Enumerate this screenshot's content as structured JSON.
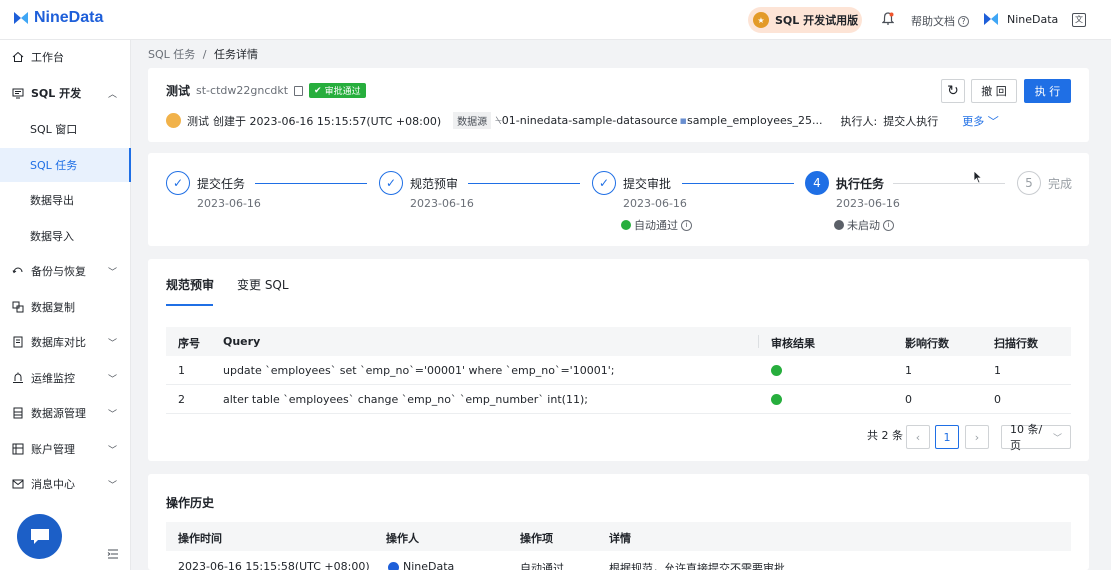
{
  "app": {
    "logo_text": "NineData",
    "trial_label": "SQL 开发试用版",
    "help_label": "帮助文档",
    "user_name": "NineData",
    "brand_color": "#1f6fe5"
  },
  "sidebar": {
    "items": [
      {
        "label": "工作台",
        "icon": "home-icon"
      },
      {
        "label": "SQL 开发",
        "icon": "sql-dev-icon"
      },
      {
        "label": "SQL 窗口"
      },
      {
        "label": "SQL 任务"
      },
      {
        "label": "数据导出"
      },
      {
        "label": "数据导入"
      },
      {
        "label": "备份与恢复",
        "icon": "backup-icon"
      },
      {
        "label": "数据复制",
        "icon": "replicate-icon"
      },
      {
        "label": "数据库对比",
        "icon": "compare-icon"
      },
      {
        "label": "运维监控",
        "icon": "monitor-icon"
      },
      {
        "label": "数据源管理",
        "icon": "datasource-icon"
      },
      {
        "label": "账户管理",
        "icon": "account-icon"
      },
      {
        "label": "消息中心",
        "icon": "message-icon"
      }
    ],
    "active": "SQL 任务"
  },
  "breadcrumb": {
    "parent": "SQL 任务",
    "separator": "/",
    "current": "任务详情"
  },
  "task": {
    "name": "测试",
    "id": "st-ctdw22gncdkt",
    "status": "审批通过",
    "creator": "测试",
    "created_text": "创建于 2023-06-16 15:15:57(UTC +08:00)",
    "datasource_label": "数据源",
    "datasource": "01-ninedata-sample-datasource",
    "database": "sample_employees_25...",
    "executor_label": "执行人:",
    "executor": "提交人执行",
    "more_label": "更多"
  },
  "buttons": {
    "refresh": "↻",
    "revoke": "撤 回",
    "execute": "执 行"
  },
  "steps": [
    {
      "title": "提交任务",
      "date": "2023-06-16",
      "state": "done",
      "note": ""
    },
    {
      "title": "规范预审",
      "date": "2023-06-16",
      "state": "done",
      "note": ""
    },
    {
      "title": "提交审批",
      "date": "2023-06-16",
      "state": "done",
      "note": "自动通过"
    },
    {
      "title": "执行任务",
      "date": "2023-06-16",
      "state": "active",
      "num": "4",
      "note": "未启动"
    },
    {
      "title": "完成",
      "date": "",
      "state": "todo",
      "num": "5",
      "note": ""
    }
  ],
  "tabs": {
    "review": "规范预审",
    "sql": "变更 SQL"
  },
  "review_table": {
    "headers": [
      "序号",
      "Query",
      "审核结果",
      "影响行数",
      "扫描行数"
    ],
    "rows": [
      {
        "no": "1",
        "query": "update `employees` set `emp_no`='00001' where `emp_no`='10001';",
        "result": "pass",
        "affected": "1",
        "scanned": "1"
      },
      {
        "no": "2",
        "query": "alter table `employees` change `emp_no` `emp_number` int(11);",
        "result": "pass",
        "affected": "0",
        "scanned": "0"
      }
    ],
    "total_text": "共 2 条",
    "page": "1",
    "page_size": "10 条/页"
  },
  "history": {
    "title": "操作历史",
    "headers": [
      "操作时间",
      "操作人",
      "操作项",
      "详情"
    ],
    "rows": [
      {
        "time": "2023-06-16 15:15:58(UTC +08:00)",
        "operator": "NineData",
        "action": "自动通过",
        "detail": "根据规范，允许直接提交不需要审批"
      }
    ]
  }
}
